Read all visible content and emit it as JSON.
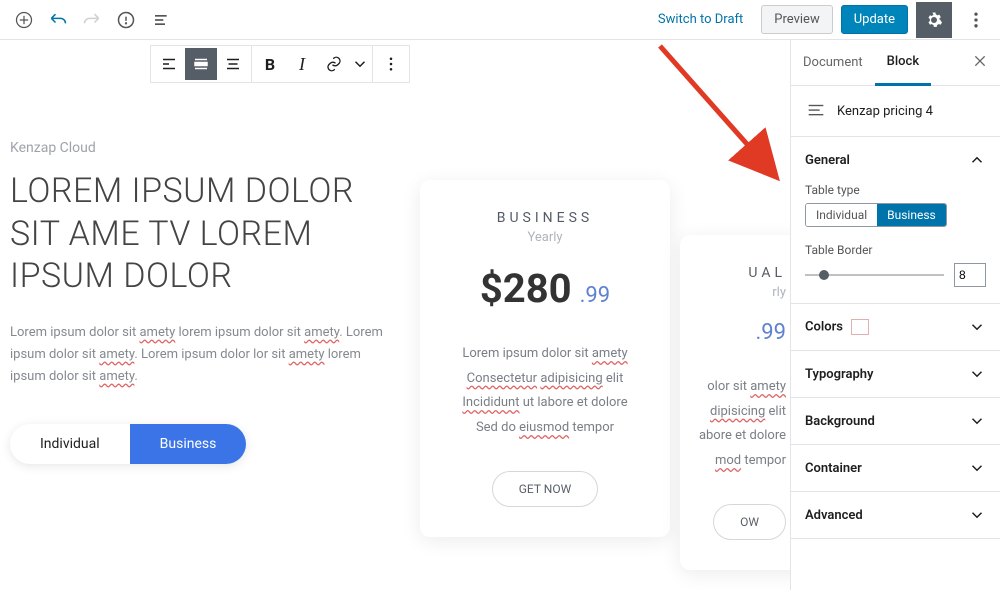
{
  "topbar": {
    "switch_draft": "Switch to Draft",
    "preview": "Preview",
    "update": "Update"
  },
  "hero": {
    "brand": "Kenzap Cloud",
    "title": "LOREM IPSUM DOLOR SIT AME TV LOREM IPSUM DOLOR",
    "desc_prefix": "Lorem ipsum dolor sit ",
    "desc_mark1": "amety",
    "desc_mid1": " lorem ipsum dolor sit ",
    "desc_mark2": "amety",
    "desc_mid2": ". Lorem ipsum dolor sit ",
    "desc_mark3": "amety",
    "desc_mid3": ". Lorem ipsum dolor lor sit ",
    "desc_mark4": "amety",
    "desc_mid4": " lorem ipsum dolor sit ",
    "desc_mark5": "amety",
    "desc_end": ".",
    "tab_individual": "Individual",
    "tab_business": "Business"
  },
  "card_main": {
    "title": "BUSINESS",
    "sub": "Yearly",
    "price_big": "$280",
    "price_small": ".99",
    "desc_l1a": "Lorem ipsum dolor sit ",
    "desc_l1b": "amety",
    "desc_l2a": "Consectetur",
    "desc_l2b": "adipisicing",
    "desc_l2c": " elit",
    "desc_l3a": "Incididunt",
    "desc_l3b": " ut labore et dolore",
    "desc_l4a": "Sed do ",
    "desc_l4b": "eiusmod",
    "desc_l4c": " tempor",
    "btn": "GET NOW"
  },
  "card_peek": {
    "title": "UAL",
    "sub": "rly",
    "price_small": ".99",
    "d1a": "olor sit ",
    "d1b": "amety",
    "d2a": "dipisicing",
    "d2b": " elit",
    "d3": "abore et dolore",
    "d4a": "mod",
    "d4b": " tempor",
    "btn": "OW"
  },
  "sidebar": {
    "tabs": {
      "document": "Document",
      "block": "Block"
    },
    "block_name": "Kenzap pricing 4",
    "panels": {
      "general": "General",
      "colors": "Colors",
      "typography": "Typography",
      "background": "Background",
      "container": "Container",
      "advanced": "Advanced"
    },
    "general": {
      "table_type_label": "Table type",
      "individual": "Individual",
      "business": "Business",
      "table_border_label": "Table Border",
      "table_border_value": "8"
    }
  }
}
